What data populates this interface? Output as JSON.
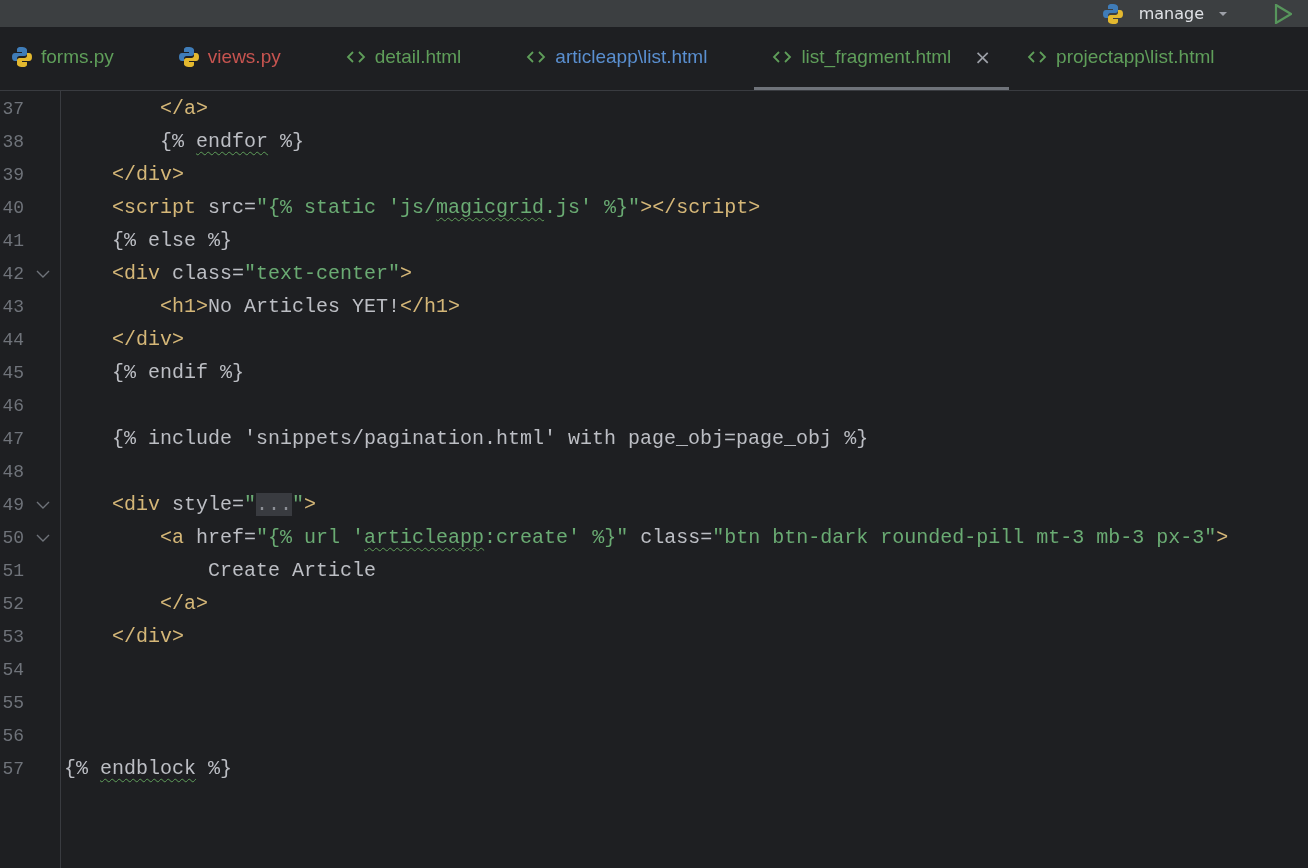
{
  "run_bar": {
    "configuration": "manage"
  },
  "tabs": [
    {
      "label": "forms.py",
      "kind": "python",
      "color": "#5f9e5a",
      "selected": false
    },
    {
      "label": "views.py",
      "kind": "python",
      "color": "#c75450",
      "selected": false
    },
    {
      "label": "detail.html",
      "kind": "html",
      "color": "#5f9e5a",
      "selected": false
    },
    {
      "label": "articleapp\\list.html",
      "kind": "html",
      "color": "#5a8fd0",
      "selected": false
    },
    {
      "label": "list_fragment.html",
      "kind": "html",
      "color": "#5f9e5a",
      "selected": true,
      "close": "×"
    },
    {
      "label": "projectapp\\list.html",
      "kind": "html",
      "color": "#5f9e5a",
      "selected": false
    }
  ],
  "lines": [
    {
      "number": "37",
      "foldable": false,
      "tokens": [
        {
          "text": "        </a>",
          "kind": "tag"
        }
      ]
    },
    {
      "number": "38",
      "foldable": false,
      "tokens": [
        {
          "text": "        {% ",
          "kind": "plain"
        },
        {
          "text": "endfor",
          "kind": "plain-typo"
        },
        {
          "text": " %}",
          "kind": "plain"
        }
      ]
    },
    {
      "number": "39",
      "foldable": false,
      "tokens": [
        {
          "text": "    </div>",
          "kind": "tag"
        }
      ]
    },
    {
      "number": "40",
      "foldable": false,
      "tokens": [
        {
          "text": "    <script",
          "kind": "tag"
        },
        {
          "text": " src=",
          "kind": "plain"
        },
        {
          "text": "\"{% static 'js/",
          "kind": "string"
        },
        {
          "text": "magicgrid",
          "kind": "string-typo"
        },
        {
          "text": ".js' %}\"",
          "kind": "string"
        },
        {
          "text": "></script>",
          "kind": "tag"
        }
      ]
    },
    {
      "number": "41",
      "foldable": false,
      "tokens": [
        {
          "text": "    {% else %}",
          "kind": "plain"
        }
      ]
    },
    {
      "number": "42",
      "foldable": true,
      "tokens": [
        {
          "text": "    <div",
          "kind": "tag"
        },
        {
          "text": " class=",
          "kind": "plain"
        },
        {
          "text": "\"text-center\"",
          "kind": "string"
        },
        {
          "text": ">",
          "kind": "tag"
        }
      ]
    },
    {
      "number": "43",
      "foldable": false,
      "tokens": [
        {
          "text": "        <h1>",
          "kind": "tag"
        },
        {
          "text": "No Articles YET!",
          "kind": "plain"
        },
        {
          "text": "</h1>",
          "kind": "tag"
        }
      ]
    },
    {
      "number": "44",
      "foldable": false,
      "tokens": [
        {
          "text": "    </div>",
          "kind": "tag"
        }
      ]
    },
    {
      "number": "45",
      "foldable": false,
      "tokens": [
        {
          "text": "    {% endif %}",
          "kind": "plain"
        }
      ]
    },
    {
      "number": "46",
      "foldable": false
    },
    {
      "number": "47",
      "foldable": false,
      "tokens": [
        {
          "text": "    {% include 'snippets/pagination.html' with page_obj=page_obj %}",
          "kind": "plain"
        }
      ]
    },
    {
      "number": "48",
      "foldable": false
    },
    {
      "number": "49",
      "foldable": true,
      "tokens": [
        {
          "text": "    <div",
          "kind": "tag"
        },
        {
          "text": " style=",
          "kind": "plain"
        },
        {
          "text": "\"",
          "kind": "string"
        },
        {
          "text": "...",
          "kind": "folded"
        },
        {
          "text": "\"",
          "kind": "string"
        },
        {
          "text": ">",
          "kind": "tag"
        }
      ]
    },
    {
      "number": "50",
      "foldable": true,
      "tokens": [
        {
          "text": "        <a",
          "kind": "tag"
        },
        {
          "text": " href=",
          "kind": "plain"
        },
        {
          "text": "\"{% url '",
          "kind": "string"
        },
        {
          "text": "articleapp",
          "kind": "string-typo"
        },
        {
          "text": ":create' %}\"",
          "kind": "string"
        },
        {
          "text": " class=",
          "kind": "plain"
        },
        {
          "text": "\"btn btn-dark rounded-pill mt-3 mb-3 px-3\"",
          "kind": "string"
        },
        {
          "text": ">",
          "kind": "tag"
        }
      ]
    },
    {
      "number": "51",
      "foldable": false,
      "tokens": [
        {
          "text": "            Create Article",
          "kind": "plain"
        }
      ]
    },
    {
      "number": "52",
      "foldable": false,
      "tokens": [
        {
          "text": "        </a>",
          "kind": "tag"
        }
      ]
    },
    {
      "number": "53",
      "foldable": false,
      "tokens": [
        {
          "text": "    </div>",
          "kind": "tag"
        }
      ]
    },
    {
      "number": "54",
      "foldable": false
    },
    {
      "number": "55",
      "foldable": false
    },
    {
      "number": "56",
      "foldable": false
    },
    {
      "number": "57",
      "foldable": false,
      "tokens": [
        {
          "text": "{% ",
          "kind": "plain"
        },
        {
          "text": "endblock",
          "kind": "plain-typo"
        },
        {
          "text": " %}",
          "kind": "plain"
        }
      ]
    }
  ]
}
